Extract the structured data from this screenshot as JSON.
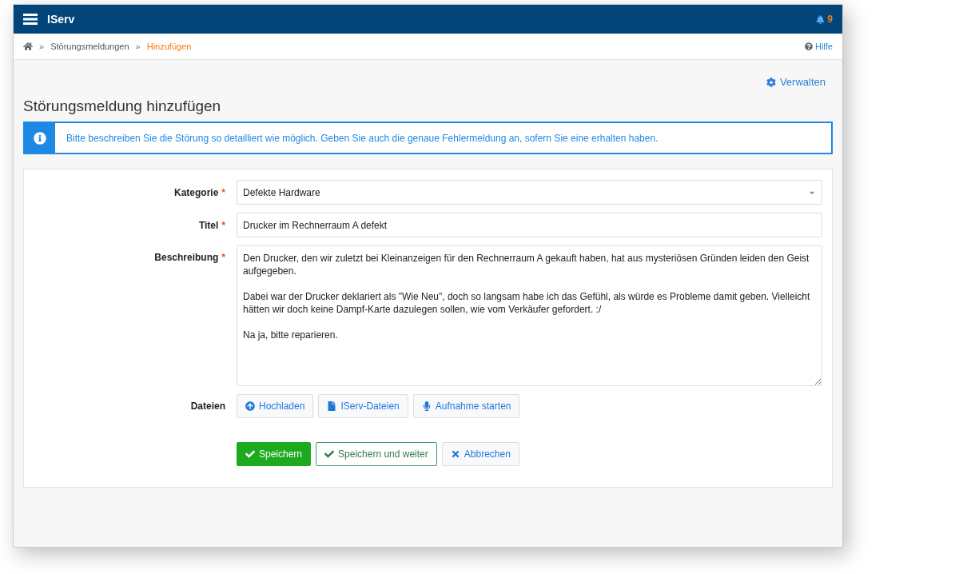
{
  "navbar": {
    "brand": "IServ",
    "notifications": "9"
  },
  "breadcrumb": {
    "items": [
      {
        "label": "Störungsmeldungen",
        "selected": false
      },
      {
        "label": "Hinzufügen",
        "selected": true
      }
    ],
    "separator": "»",
    "help": "Hilfe"
  },
  "manage_link": "Verwalten",
  "page_title": "Störungsmeldung hinzufügen",
  "info_alert": "Bitte beschreiben Sie die Störung so detailliert wie möglich. Geben Sie auch die genaue Fehlermeldung an, sofern Sie eine erhalten haben.",
  "form": {
    "fields": [
      {
        "kind": "select",
        "label": "Kategorie",
        "required_mark": "*",
        "value": "Defekte Hardware"
      },
      {
        "kind": "text",
        "label": "Titel",
        "required_mark": "*",
        "value": "Drucker im Rechnerraum A defekt"
      },
      {
        "kind": "textarea",
        "label": "Beschreibung",
        "required_mark": "*",
        "value": "Den Drucker, den wir zuletzt bei Kleinanzeigen für den Rechnerraum A gekauft haben, hat aus mysteriösen Gründen leiden den Geist aufgegeben.\n\nDabei war der Drucker deklariert als \"Wie Neu\", doch so langsam habe ich das Gefühl, als würde es Probleme damit geben. Vielleicht hätten wir doch keine Dampf-Karte dazulegen sollen, wie vom Verkäufer gefordert. :/\n\nNa ja, bitte reparieren."
      }
    ],
    "files": {
      "label": "Dateien",
      "buttons": [
        {
          "kind": "upload",
          "label": "Hochladen"
        },
        {
          "kind": "file",
          "label": "IServ-Dateien"
        },
        {
          "kind": "mic",
          "label": "Aufnahme starten"
        }
      ]
    },
    "actions": [
      {
        "kind": "primary",
        "label": "Speichern"
      },
      {
        "kind": "outline",
        "label": "Speichern und weiter"
      },
      {
        "kind": "cancel",
        "label": "Abbrechen"
      }
    ]
  }
}
